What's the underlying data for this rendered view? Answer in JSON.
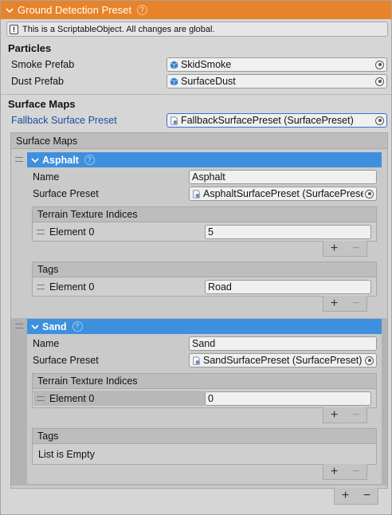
{
  "header": {
    "title": "Ground Detection Preset",
    "help_glyph": "?"
  },
  "info": {
    "glyph": "!",
    "text": "This is a ScriptableObject. All changes are global."
  },
  "particles": {
    "title": "Particles",
    "smoke": {
      "label": "Smoke Prefab",
      "value": "SkidSmoke"
    },
    "dust": {
      "label": "Dust Prefab",
      "value": "SurfaceDust"
    }
  },
  "surface_maps": {
    "title": "Surface Maps",
    "fallback": {
      "label": "Fallback Surface Preset",
      "value": "FallbackSurfacePreset (SurfacePreset)"
    },
    "list_title": "Surface Maps",
    "elements": [
      {
        "title": "Asphalt",
        "name_label": "Name",
        "name_value": "Asphalt",
        "preset_label": "Surface Preset",
        "preset_value": "AsphaltSurfacePreset (SurfacePreset)",
        "indices_title": "Terrain Texture Indices",
        "indices": [
          {
            "label": "Element 0",
            "value": "5"
          }
        ],
        "tags_title": "Tags",
        "tags": [
          {
            "label": "Element 0",
            "value": "Road"
          }
        ]
      },
      {
        "title": "Sand",
        "name_label": "Name",
        "name_value": "Sand",
        "preset_label": "Surface Preset",
        "preset_value": "SandSurfacePreset (SurfacePreset)",
        "indices_title": "Terrain Texture Indices",
        "indices": [
          {
            "label": "Element 0",
            "value": "0"
          }
        ],
        "tags_title": "Tags",
        "tags_empty": "List is Empty"
      }
    ]
  },
  "list_controls": {
    "add": "+",
    "remove": "−"
  },
  "colors": {
    "header": "#e8832a",
    "element_header": "#3e90df",
    "link": "#1a4da1"
  },
  "icons": {
    "prefab": "cube-icon",
    "preset": "scriptable-object-icon",
    "picker": "object-picker-icon"
  }
}
